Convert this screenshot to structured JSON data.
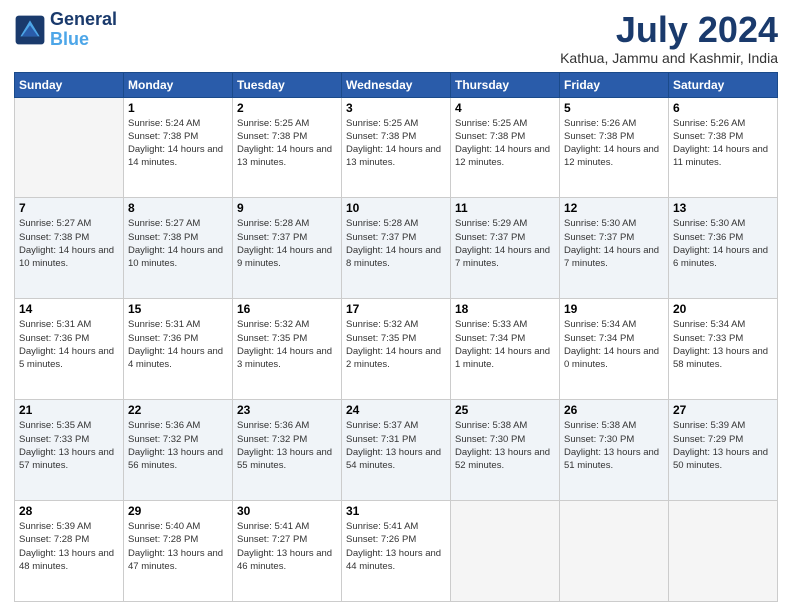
{
  "header": {
    "logo_line1": "General",
    "logo_line2": "Blue",
    "month": "July 2024",
    "location": "Kathua, Jammu and Kashmir, India"
  },
  "weekdays": [
    "Sunday",
    "Monday",
    "Tuesday",
    "Wednesday",
    "Thursday",
    "Friday",
    "Saturday"
  ],
  "weeks": [
    [
      {
        "day": "",
        "empty": true
      },
      {
        "day": "1",
        "sunrise": "5:24 AM",
        "sunset": "7:38 PM",
        "daylight": "14 hours and 14 minutes."
      },
      {
        "day": "2",
        "sunrise": "5:25 AM",
        "sunset": "7:38 PM",
        "daylight": "14 hours and 13 minutes."
      },
      {
        "day": "3",
        "sunrise": "5:25 AM",
        "sunset": "7:38 PM",
        "daylight": "14 hours and 13 minutes."
      },
      {
        "day": "4",
        "sunrise": "5:25 AM",
        "sunset": "7:38 PM",
        "daylight": "14 hours and 12 minutes."
      },
      {
        "day": "5",
        "sunrise": "5:26 AM",
        "sunset": "7:38 PM",
        "daylight": "14 hours and 12 minutes."
      },
      {
        "day": "6",
        "sunrise": "5:26 AM",
        "sunset": "7:38 PM",
        "daylight": "14 hours and 11 minutes."
      }
    ],
    [
      {
        "day": "7",
        "sunrise": "5:27 AM",
        "sunset": "7:38 PM",
        "daylight": "14 hours and 10 minutes."
      },
      {
        "day": "8",
        "sunrise": "5:27 AM",
        "sunset": "7:38 PM",
        "daylight": "14 hours and 10 minutes."
      },
      {
        "day": "9",
        "sunrise": "5:28 AM",
        "sunset": "7:37 PM",
        "daylight": "14 hours and 9 minutes."
      },
      {
        "day": "10",
        "sunrise": "5:28 AM",
        "sunset": "7:37 PM",
        "daylight": "14 hours and 8 minutes."
      },
      {
        "day": "11",
        "sunrise": "5:29 AM",
        "sunset": "7:37 PM",
        "daylight": "14 hours and 7 minutes."
      },
      {
        "day": "12",
        "sunrise": "5:30 AM",
        "sunset": "7:37 PM",
        "daylight": "14 hours and 7 minutes."
      },
      {
        "day": "13",
        "sunrise": "5:30 AM",
        "sunset": "7:36 PM",
        "daylight": "14 hours and 6 minutes."
      }
    ],
    [
      {
        "day": "14",
        "sunrise": "5:31 AM",
        "sunset": "7:36 PM",
        "daylight": "14 hours and 5 minutes."
      },
      {
        "day": "15",
        "sunrise": "5:31 AM",
        "sunset": "7:36 PM",
        "daylight": "14 hours and 4 minutes."
      },
      {
        "day": "16",
        "sunrise": "5:32 AM",
        "sunset": "7:35 PM",
        "daylight": "14 hours and 3 minutes."
      },
      {
        "day": "17",
        "sunrise": "5:32 AM",
        "sunset": "7:35 PM",
        "daylight": "14 hours and 2 minutes."
      },
      {
        "day": "18",
        "sunrise": "5:33 AM",
        "sunset": "7:34 PM",
        "daylight": "14 hours and 1 minute."
      },
      {
        "day": "19",
        "sunrise": "5:34 AM",
        "sunset": "7:34 PM",
        "daylight": "14 hours and 0 minutes."
      },
      {
        "day": "20",
        "sunrise": "5:34 AM",
        "sunset": "7:33 PM",
        "daylight": "13 hours and 58 minutes."
      }
    ],
    [
      {
        "day": "21",
        "sunrise": "5:35 AM",
        "sunset": "7:33 PM",
        "daylight": "13 hours and 57 minutes."
      },
      {
        "day": "22",
        "sunrise": "5:36 AM",
        "sunset": "7:32 PM",
        "daylight": "13 hours and 56 minutes."
      },
      {
        "day": "23",
        "sunrise": "5:36 AM",
        "sunset": "7:32 PM",
        "daylight": "13 hours and 55 minutes."
      },
      {
        "day": "24",
        "sunrise": "5:37 AM",
        "sunset": "7:31 PM",
        "daylight": "13 hours and 54 minutes."
      },
      {
        "day": "25",
        "sunrise": "5:38 AM",
        "sunset": "7:30 PM",
        "daylight": "13 hours and 52 minutes."
      },
      {
        "day": "26",
        "sunrise": "5:38 AM",
        "sunset": "7:30 PM",
        "daylight": "13 hours and 51 minutes."
      },
      {
        "day": "27",
        "sunrise": "5:39 AM",
        "sunset": "7:29 PM",
        "daylight": "13 hours and 50 minutes."
      }
    ],
    [
      {
        "day": "28",
        "sunrise": "5:39 AM",
        "sunset": "7:28 PM",
        "daylight": "13 hours and 48 minutes."
      },
      {
        "day": "29",
        "sunrise": "5:40 AM",
        "sunset": "7:28 PM",
        "daylight": "13 hours and 47 minutes."
      },
      {
        "day": "30",
        "sunrise": "5:41 AM",
        "sunset": "7:27 PM",
        "daylight": "13 hours and 46 minutes."
      },
      {
        "day": "31",
        "sunrise": "5:41 AM",
        "sunset": "7:26 PM",
        "daylight": "13 hours and 44 minutes."
      },
      {
        "day": "",
        "empty": true
      },
      {
        "day": "",
        "empty": true
      },
      {
        "day": "",
        "empty": true
      }
    ]
  ]
}
